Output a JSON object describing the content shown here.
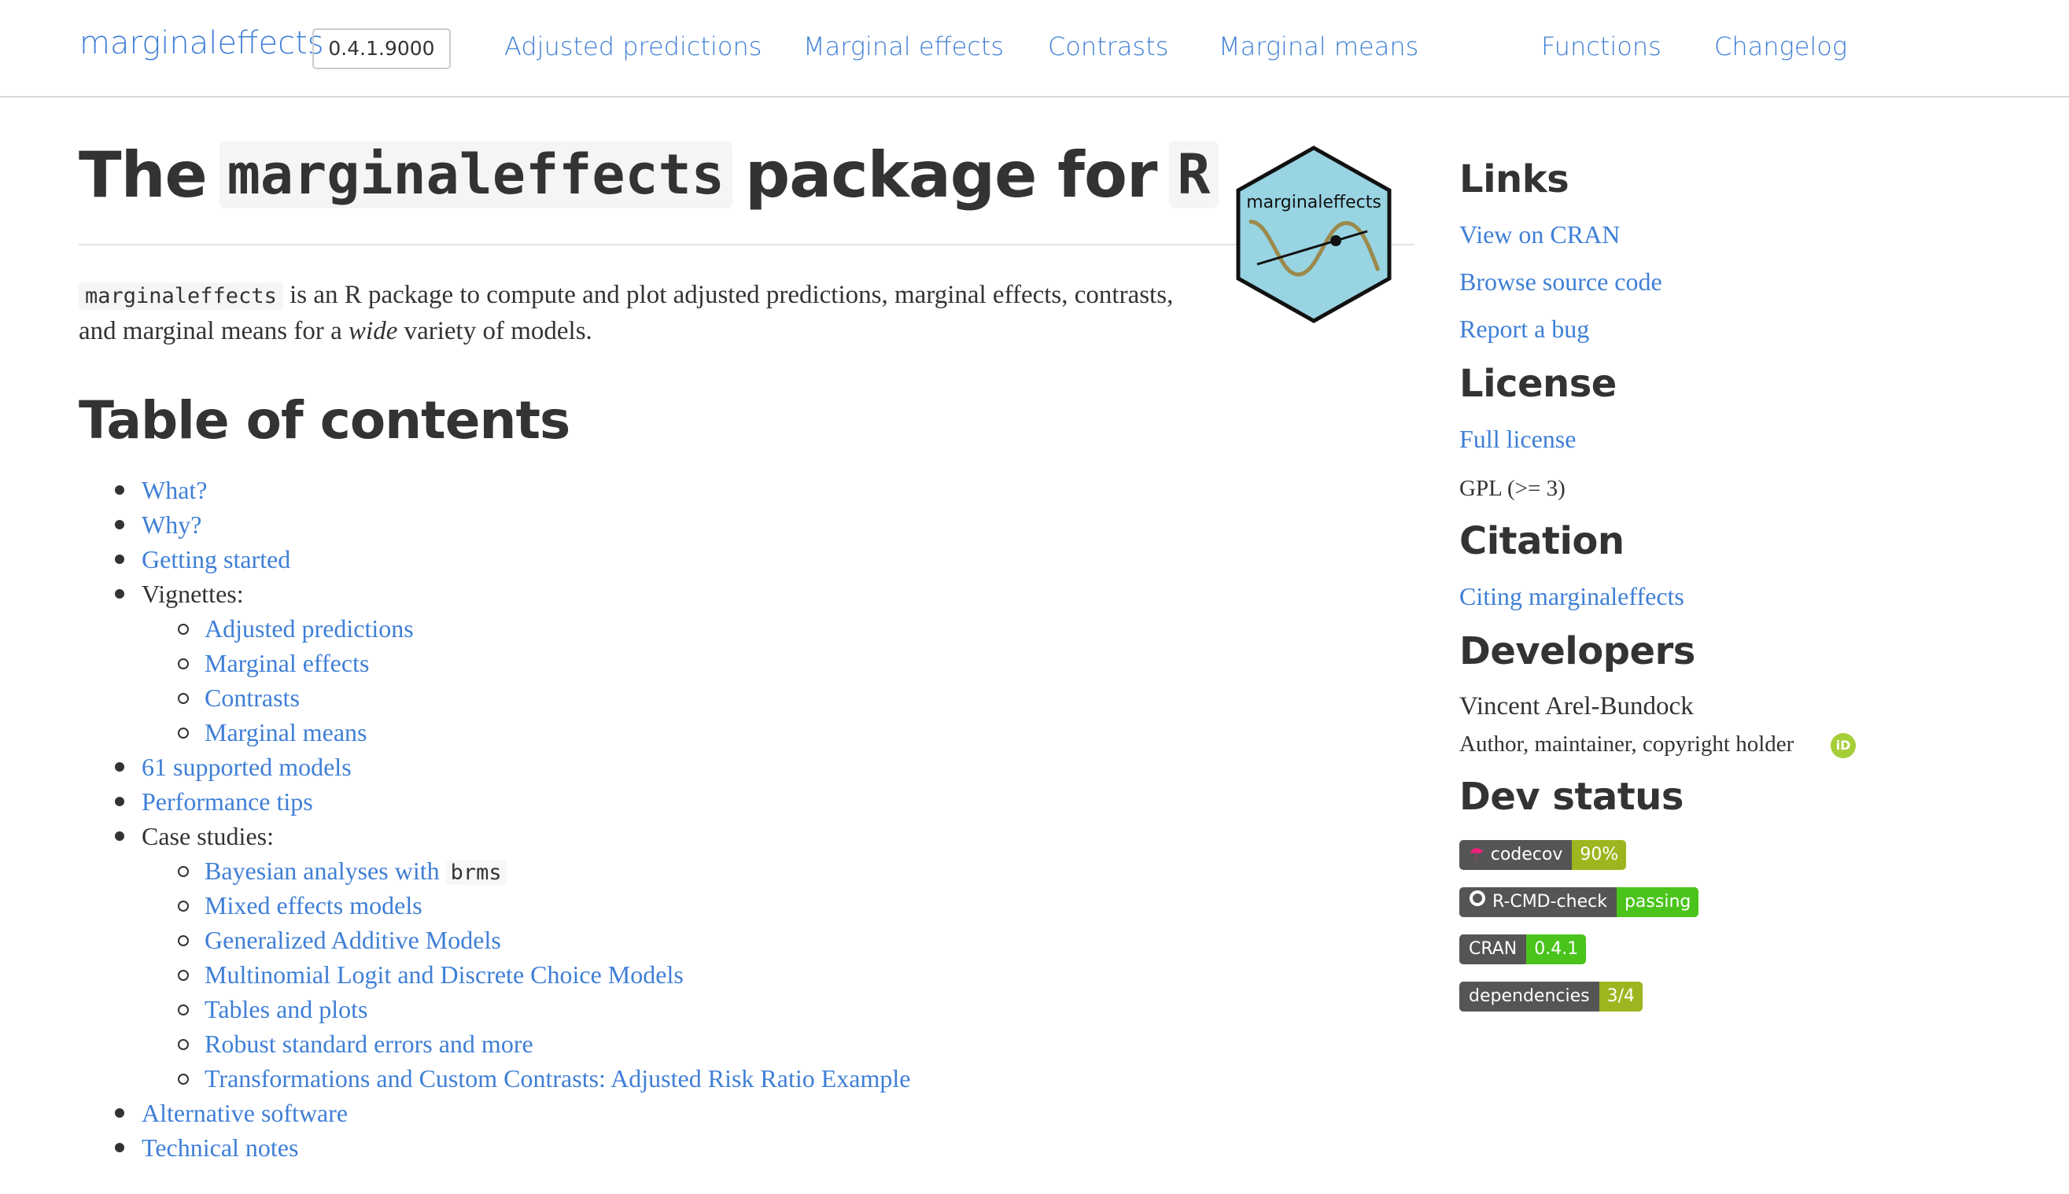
{
  "navbar": {
    "brand": "marginaleffects",
    "version": "0.4.1.9000",
    "links": [
      "Adjusted predictions",
      "Marginal effects",
      "Contrasts",
      "Marginal means",
      "Functions",
      "Changelog"
    ]
  },
  "main": {
    "title_pre": "The",
    "title_code": "marginaleffects",
    "title_mid": "package for",
    "title_r": "R",
    "logo_text": "marginaleffects",
    "intro_code": "marginaleffects",
    "intro_a": "is an R package to compute and plot adjusted predictions, marginal effects, contrasts, and marginal means for a",
    "intro_em": "wide",
    "intro_b": "variety of models.",
    "toc_heading": "Table of contents",
    "toc": [
      "What?",
      "Why?",
      "Getting started",
      "Vignettes:",
      "Adjusted predictions",
      "Marginal effects",
      "Contrasts",
      "Marginal means",
      "61 supported models",
      "Performance tips",
      "Case studies:",
      "Bayesian analyses with",
      "Mixed effects models",
      "Generalized Additive Models",
      "Multinomial Logit and Discrete Choice Models",
      "Tables and plots",
      "Robust standard errors and more",
      "Transformations and Custom Contrasts: Adjusted Risk Ratio Example",
      "Alternative software",
      "Technical notes"
    ],
    "toc_code": "brms"
  },
  "sidebar": {
    "links_heading": "Links",
    "links": [
      "View on CRAN",
      "Browse source code",
      "Report a bug"
    ],
    "license_heading": "License",
    "license_link": "Full license",
    "license_text": "GPL (>= 3)",
    "citation_heading": "Citation",
    "citation_link": "Citing marginaleffects",
    "developers_heading": "Developers",
    "developer_name": "Vincent Arel-Bundock",
    "developer_role": "Author, maintainer, copyright holder",
    "orcid": "iD",
    "devstatus_heading": "Dev status",
    "badges": [
      {
        "label": "codecov",
        "value": "90%",
        "color": "#9fb51f",
        "icon": "umbrella-icon"
      },
      {
        "label": "R-CMD-check",
        "value": "passing",
        "color": "#4ac41b",
        "icon": "github-icon"
      },
      {
        "label": "CRAN",
        "value": "0.4.1",
        "color": "#4ac41b",
        "icon": ""
      },
      {
        "label": "dependencies",
        "value": "3/4",
        "color": "#9fb51f",
        "icon": ""
      }
    ]
  },
  "colors": {
    "link": "#3f7fd6",
    "text": "#333333",
    "logo_fill": "#98d4e2"
  }
}
